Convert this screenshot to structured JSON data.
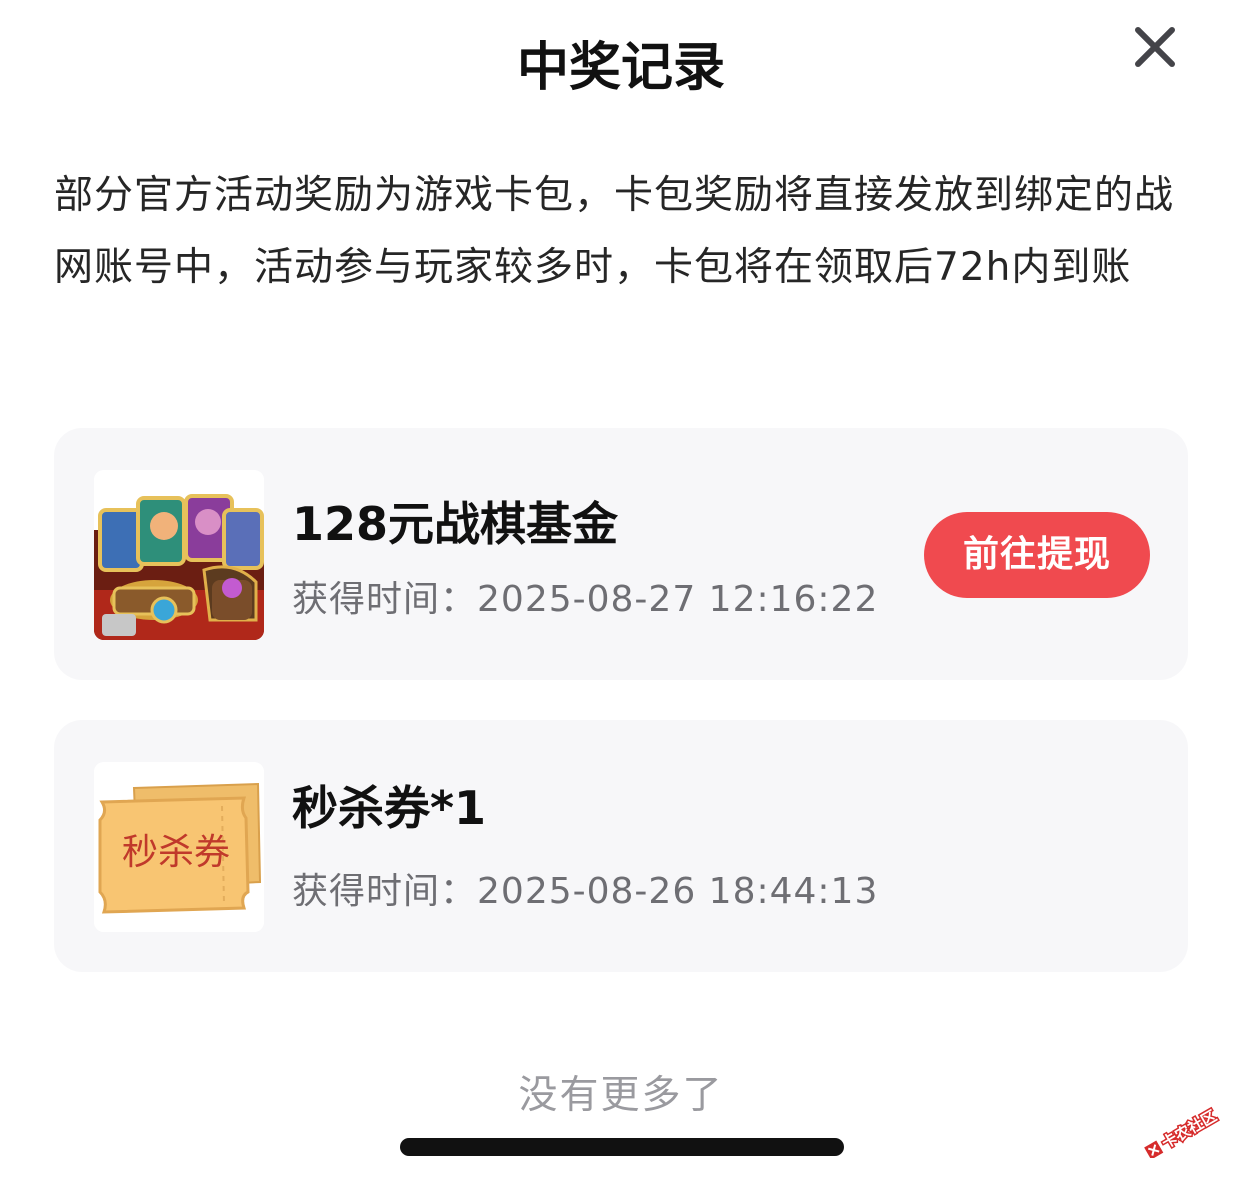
{
  "header": {
    "title": "中奖记录"
  },
  "notice": {
    "text": "部分官方活动奖励为游戏卡包，卡包奖励将直接发放到绑定的战网账号中，活动参与玩家较多时，卡包将在领取后72h内到账"
  },
  "records": [
    {
      "title": "128元战棋基金",
      "time_label": "获得时间：",
      "time_value": "2025-08-27 12:16:22",
      "action_label": "前往提现",
      "thumb_icon": "game-card-pack-image"
    },
    {
      "title": "秒杀券*1",
      "time_label": "获得时间：",
      "time_value": "2025-08-26 18:44:13",
      "thumb_text": "秒杀券",
      "thumb_icon": "coupon-ticket-image"
    }
  ],
  "footer": {
    "no_more_text": "没有更多了"
  },
  "watermark": {
    "text": "卡农社区"
  },
  "colors": {
    "accent": "#f04a4f",
    "card_bg": "#f7f7f9",
    "muted_text": "#6e6e73",
    "coupon_bg": "#f8c572"
  }
}
